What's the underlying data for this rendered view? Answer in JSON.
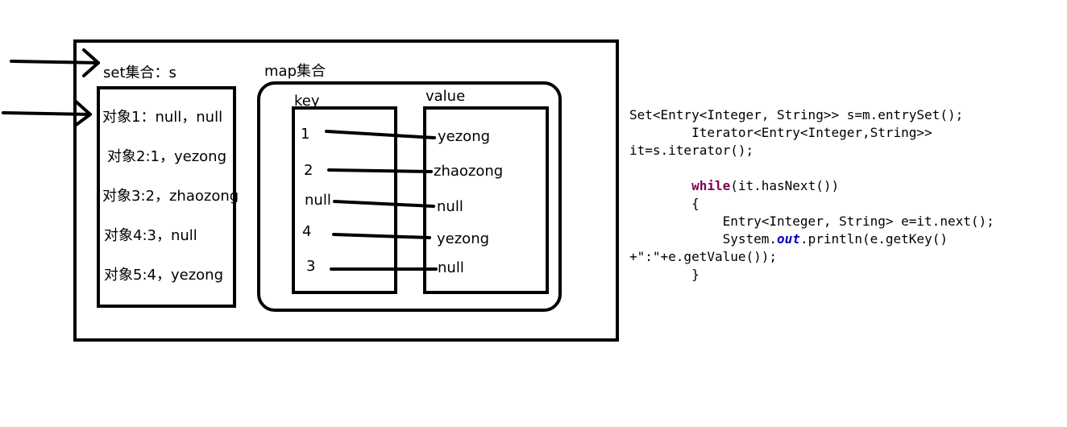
{
  "set": {
    "title": "set集合：s",
    "items": [
      "对象1：null，null",
      "对象2:1，yezong",
      "对象3:2，zhaozong",
      "对象4:3，null",
      "对象5:4，yezong"
    ]
  },
  "map": {
    "title": "map集合",
    "key_header": "key",
    "value_header": "value",
    "keys": [
      "1",
      "2",
      "null",
      "4",
      "3"
    ],
    "values": [
      "yezong",
      "zhaozong",
      "null",
      "yezong",
      "null"
    ]
  },
  "code": {
    "line1": "Set<Entry<Integer, String>> s=m.entrySet();",
    "line2": "        Iterator<Entry<Integer,String>>",
    "line3": "it=s.iterator();",
    "line4_indent": "        ",
    "line4_kw": "while",
    "line4_rest": "(it.hasNext())",
    "line5": "        {",
    "line6": "            Entry<Integer, String> e=it.next();",
    "line7_pre": "            System.",
    "line7_field": "out",
    "line7_post": ".println(e.getKey()",
    "line8": "+\":\"+e.getValue());",
    "line9": "        }"
  }
}
